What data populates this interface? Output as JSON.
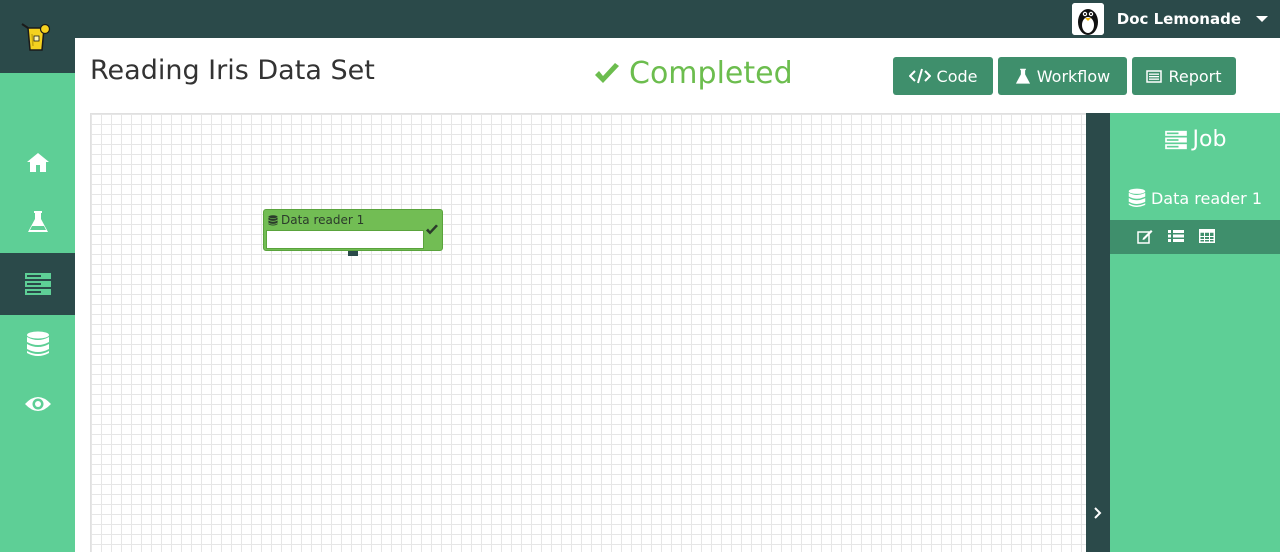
{
  "header": {
    "user_name": "Doc Lemonade",
    "logo": "lemonade-glass-icon",
    "avatar": "penguin-avatar"
  },
  "sidebar": {
    "items": [
      {
        "name": "home",
        "icon": "home-icon"
      },
      {
        "name": "experiments",
        "icon": "flask-icon"
      },
      {
        "name": "jobs",
        "icon": "server-icon",
        "active": true
      },
      {
        "name": "datasources",
        "icon": "database-icon"
      },
      {
        "name": "visualizations",
        "icon": "eye-icon"
      }
    ]
  },
  "page": {
    "title": "Reading Iris Data Set",
    "status": "Completed"
  },
  "toolbar": {
    "code_label": "Code",
    "workflow_label": "Workflow",
    "report_label": "Report"
  },
  "workflow": {
    "node": {
      "title": "Data reader 1",
      "state": "completed"
    }
  },
  "right_panel": {
    "title": "Job",
    "item_label": "Data reader 1"
  },
  "colors": {
    "dark": "#2b4a4a",
    "accent": "#5ecf96",
    "button": "#3f8f6c",
    "success": "#6cbd4e"
  }
}
